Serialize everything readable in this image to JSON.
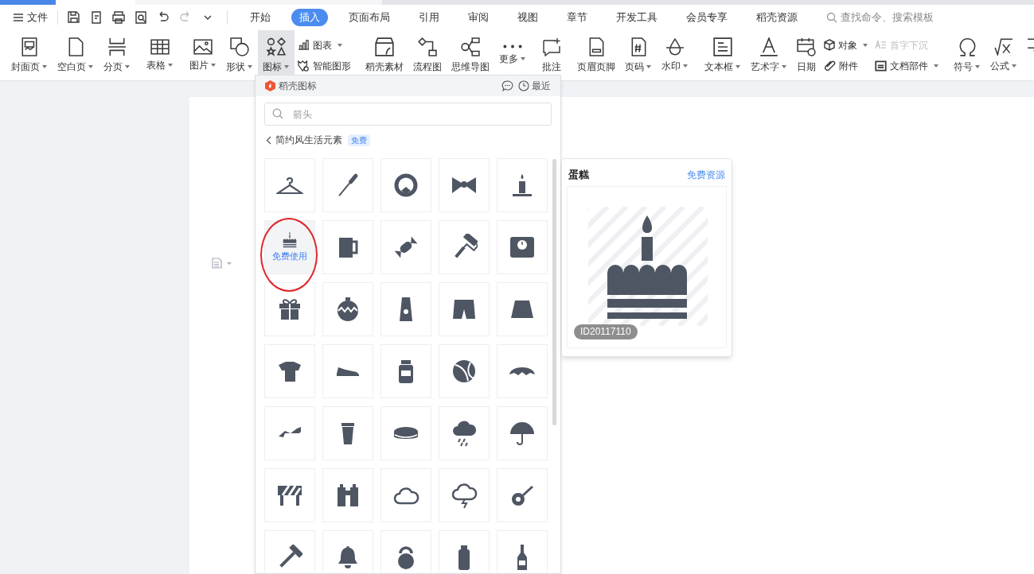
{
  "menu_bar": {
    "file_menu": "文件",
    "tabs": [
      {
        "label": "开始",
        "selected": false
      },
      {
        "label": "插入",
        "selected": true
      },
      {
        "label": "页面布局",
        "selected": false
      },
      {
        "label": "引用",
        "selected": false
      },
      {
        "label": "审阅",
        "selected": false
      },
      {
        "label": "视图",
        "selected": false
      },
      {
        "label": "章节",
        "selected": false
      },
      {
        "label": "开发工具",
        "selected": false
      },
      {
        "label": "会员专享",
        "selected": false
      },
      {
        "label": "稻壳资源",
        "selected": false
      }
    ],
    "search": {
      "placeholder": "查找命令、搜索模板"
    }
  },
  "ribbon": {
    "groups": [
      {
        "items": [
          {
            "kind": "large",
            "label": "封面页",
            "caret": true
          },
          {
            "kind": "large",
            "label": "空白页",
            "caret": true
          },
          {
            "kind": "large",
            "label": "分页",
            "caret": true
          }
        ]
      },
      {
        "items": [
          {
            "kind": "large",
            "label": "表格",
            "caret": true
          }
        ]
      },
      {
        "items": [
          {
            "kind": "large",
            "label": "图片",
            "caret": true
          },
          {
            "kind": "large",
            "label": "形状",
            "caret": true
          },
          {
            "kind": "large",
            "label": "图标",
            "caret": true,
            "selected": true
          },
          {
            "kind": "stack",
            "items": [
              {
                "label": "图表",
                "caret": true,
                "disabled": false
              },
              {
                "label": "智能图形",
                "caret": false,
                "disabled": false
              }
            ]
          }
        ]
      },
      {
        "items": [
          {
            "kind": "large",
            "label": "稻壳素材",
            "caret": false
          },
          {
            "kind": "large",
            "label": "流程图",
            "caret": false
          },
          {
            "kind": "large",
            "label": "思维导图",
            "caret": false
          },
          {
            "kind": "large",
            "label": "更多",
            "caret": true
          }
        ]
      },
      {
        "items": [
          {
            "kind": "large",
            "label": "批注",
            "caret": false
          }
        ]
      },
      {
        "items": [
          {
            "kind": "large",
            "label": "页眉页脚",
            "caret": false
          },
          {
            "kind": "large",
            "label": "页码",
            "caret": true
          },
          {
            "kind": "large",
            "label": "水印",
            "caret": true
          }
        ]
      },
      {
        "items": [
          {
            "kind": "large",
            "label": "文本框",
            "caret": true
          },
          {
            "kind": "large",
            "label": "艺术字",
            "caret": true
          },
          {
            "kind": "large",
            "label": "日期",
            "caret": false
          },
          {
            "kind": "stack",
            "items": [
              {
                "label": "对象",
                "caret": true,
                "disabled": false
              },
              {
                "label": "附件",
                "caret": false,
                "disabled": false
              }
            ]
          },
          {
            "kind": "stack",
            "items": [
              {
                "label": "首字下沉",
                "caret": false,
                "disabled": true
              },
              {
                "label": "文档部件",
                "caret": true,
                "disabled": false
              }
            ]
          }
        ]
      },
      {
        "items": [
          {
            "kind": "large",
            "label": "符号",
            "caret": true
          },
          {
            "kind": "large",
            "label": "公式",
            "caret": true
          },
          {
            "kind": "icon"
          }
        ]
      }
    ]
  },
  "icon_panel": {
    "title": "稻壳图标",
    "recent": "最近",
    "search": {
      "placeholder": "箭头"
    },
    "category": "简约风生活元素",
    "badge": "免费",
    "cells": [
      {
        "selected": false
      },
      {
        "selected": false
      },
      {
        "selected": false
      },
      {
        "selected": false
      },
      {
        "selected": false
      },
      {
        "selected": true,
        "hover_label": "免费使用"
      },
      {
        "selected": false
      },
      {
        "selected": false
      },
      {
        "selected": false
      },
      {
        "selected": false
      },
      {
        "selected": false
      },
      {
        "selected": false
      },
      {
        "selected": false
      },
      {
        "selected": false
      },
      {
        "selected": false
      },
      {
        "selected": false
      },
      {
        "selected": false
      },
      {
        "selected": false
      },
      {
        "selected": false
      },
      {
        "selected": false
      },
      {
        "selected": false
      },
      {
        "selected": false
      },
      {
        "selected": false
      },
      {
        "selected": false
      },
      {
        "selected": false
      },
      {
        "selected": false
      },
      {
        "selected": false
      },
      {
        "selected": false
      },
      {
        "selected": false
      },
      {
        "selected": false
      },
      {
        "selected": false
      },
      {
        "selected": false
      },
      {
        "selected": false
      },
      {
        "selected": false
      },
      {
        "selected": false
      }
    ]
  },
  "preview": {
    "title": "蛋糕",
    "link": "免费资源",
    "id": "ID20117110"
  },
  "annotation_circle": true
}
